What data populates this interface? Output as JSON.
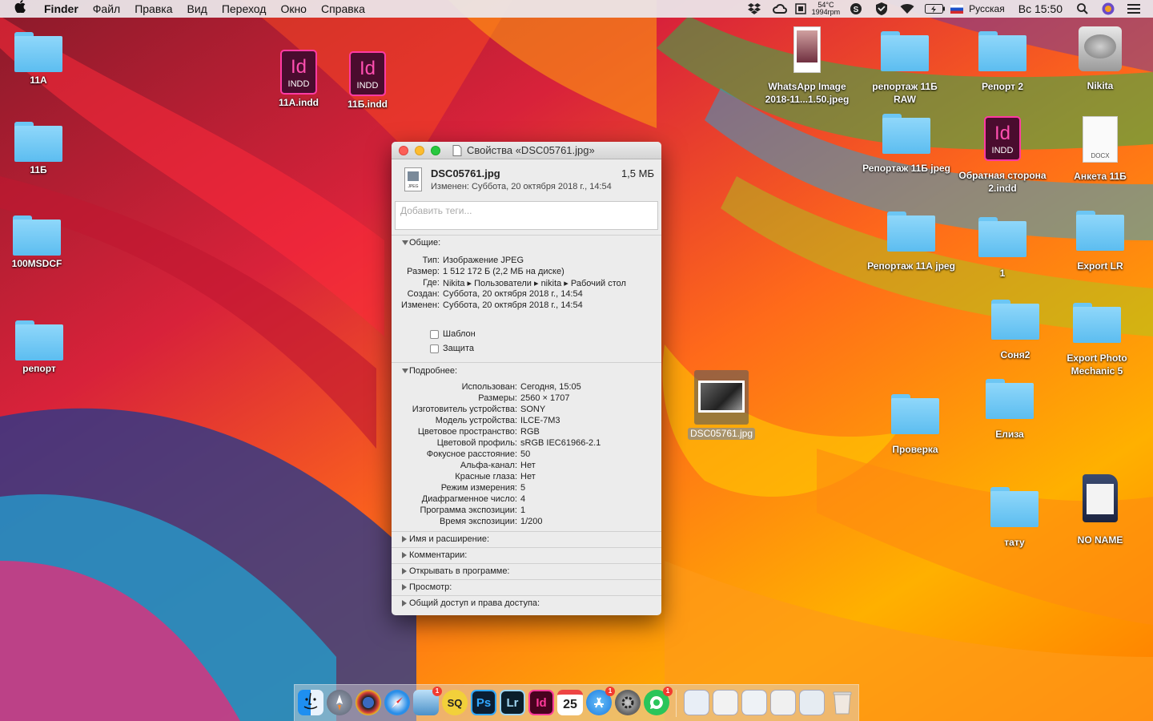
{
  "menubar": {
    "app": "Finder",
    "menus": [
      "Файл",
      "Правка",
      "Вид",
      "Переход",
      "Окно",
      "Справка"
    ],
    "temp_cpu": "54°C",
    "fan": "1994rpm",
    "input_source": "Русская",
    "clock": "Вс 15:50"
  },
  "desktop": {
    "folder_11a": "11А",
    "file_11a_indd": "11А.indd",
    "file_11b_indd": "11Б.indd",
    "folder_11b": "11Б",
    "folder_100msdcf": "100MSDCF",
    "folder_report": "репорт",
    "file_whatsapp": "WhatsApp Image 2018-11...1.50.jpeg",
    "folder_reportazh_raw": "репортаж 11Б RAW",
    "folder_report2": "Репорт 2",
    "disk_nikita": "Nikita",
    "folder_reportazh_11b_jpeg": "Репортаж 11Б jpeg",
    "file_obratnaya": "Обратная сторона 2.indd",
    "file_anketa": "Анкета 11Б",
    "folder_reportazh_11a_jpeg": "Репортаж 11А jpeg",
    "folder_1": "1",
    "folder_export_lr": "Export LR",
    "folder_sonya2": "Соня2",
    "folder_export_pm": "Export Photo Mechanic 5",
    "file_dsc": "DSC05761.jpg",
    "folder_proverka": "Проверка",
    "folder_eliza": "Елиза",
    "folder_tatu": "тату",
    "disk_noname": "NO NAME",
    "indd_badge": "INDD",
    "indd_letters": "Id",
    "docx_badge": "DOCX"
  },
  "window": {
    "title": "Свойства «DSC05761.jpg»",
    "file_name": "DSC05761.jpg",
    "file_size": "1,5 МБ",
    "modified_header": "Изменен: Суббота, 20 октября 2018 г., 14:54",
    "tags_placeholder": "Добавить теги...",
    "general": {
      "header": "Общие:",
      "rows": [
        {
          "label": "Тип:",
          "value": "Изображение JPEG"
        },
        {
          "label": "Размер:",
          "value": "1 512 172 Б (2,2 МБ на диске)"
        },
        {
          "label": "Где:",
          "value": "Nikita ▸ Пользователи ▸ nikita ▸ Рабочий стол"
        },
        {
          "label": "Создан:",
          "value": "Суббота, 20 октября 2018 г., 14:54"
        },
        {
          "label": "Изменен:",
          "value": "Суббота, 20 октября 2018 г., 14:54"
        }
      ],
      "template_label": "Шаблон",
      "locked_label": "Защита"
    },
    "more": {
      "header": "Подробнее:",
      "rows": [
        {
          "label": "Использован:",
          "value": "Сегодня, 15:05"
        },
        {
          "label": "Размеры:",
          "value": "2560 × 1707"
        },
        {
          "label": "Изготовитель устройства:",
          "value": "SONY"
        },
        {
          "label": "Модель устройства:",
          "value": "ILCE-7M3"
        },
        {
          "label": "Цветовое пространство:",
          "value": "RGB"
        },
        {
          "label": "Цветовой профиль:",
          "value": "sRGB IEC61966-2.1"
        },
        {
          "label": "Фокусное расстояние:",
          "value": "50"
        },
        {
          "label": "Альфа-канал:",
          "value": "Нет"
        },
        {
          "label": "Красные глаза:",
          "value": "Нет"
        },
        {
          "label": "Режим измерения:",
          "value": "5"
        },
        {
          "label": "Диафрагменное число:",
          "value": "4"
        },
        {
          "label": "Программа экспозиции:",
          "value": "1"
        },
        {
          "label": "Время экспозиции:",
          "value": "1/200"
        }
      ]
    },
    "collapsed_sections": [
      "Имя и расширение:",
      "Комментарии:",
      "Открывать в программе:",
      "Просмотр:",
      "Общий доступ и права доступа:"
    ]
  },
  "dock": {
    "ps": "Ps",
    "lr": "Lr",
    "id": "Id",
    "sq": "SQ",
    "calendar_day": "25",
    "badge_one": "1"
  }
}
